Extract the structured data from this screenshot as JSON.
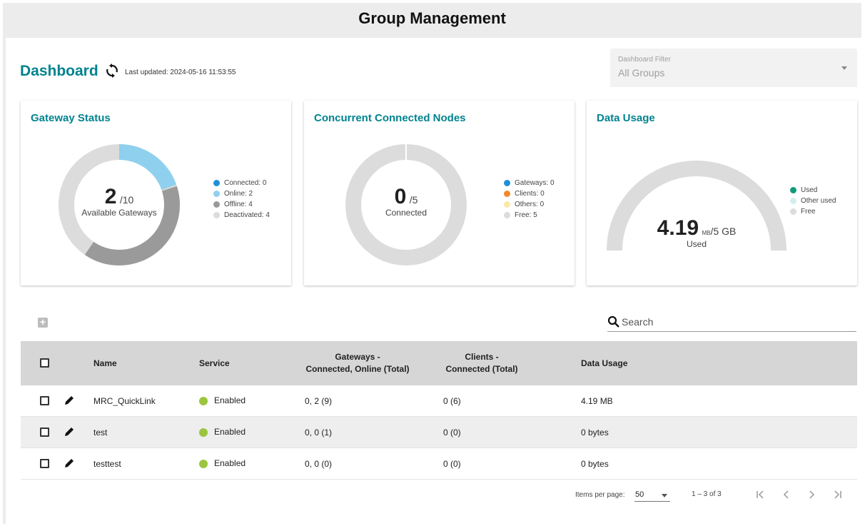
{
  "app": {
    "title": "Group Management"
  },
  "dashboard": {
    "title": "Dashboard",
    "last_updated": "Last updated: 2024-05-16 11:53:55",
    "filter": {
      "label": "Dashboard Filter",
      "value": "All Groups"
    }
  },
  "cards": {
    "gateway_status": {
      "title": "Gateway Status",
      "value": "2",
      "total": "/10",
      "subtitle": "Available Gateways",
      "legend": [
        {
          "label": "Connected: 0",
          "color": "#1e90d6",
          "value": 0
        },
        {
          "label": "Online: 2",
          "color": "#8fd0ee",
          "value": 2
        },
        {
          "label": "Offline: 4",
          "color": "#9a9a9a",
          "value": 4
        },
        {
          "label": "Deactivated: 4",
          "color": "#dcdcdc",
          "value": 4
        }
      ]
    },
    "connected_nodes": {
      "title": "Concurrent Connected Nodes",
      "value": "0",
      "total": "/5",
      "subtitle": "Connected",
      "legend": [
        {
          "label": "Gateways: 0",
          "color": "#1e90d6",
          "value": 0
        },
        {
          "label": "Clients: 0",
          "color": "#f08a2c",
          "value": 0
        },
        {
          "label": "Others: 0",
          "color": "#fbe8a6",
          "value": 0
        },
        {
          "label": "Free: 5",
          "color": "#dcdcdc",
          "value": 5
        }
      ]
    },
    "data_usage": {
      "title": "Data Usage",
      "value": "4.19",
      "unit": "MB",
      "total": "/5 GB",
      "subtitle": "Used",
      "legend": [
        {
          "label": "Used",
          "color": "#129a7a"
        },
        {
          "label": "Other used",
          "color": "#d4eeee"
        },
        {
          "label": "Free",
          "color": "#dcdcdc"
        }
      ]
    }
  },
  "search": {
    "placeholder": "Search"
  },
  "table": {
    "headers": {
      "name": "Name",
      "service": "Service",
      "gateways_line1": "Gateways -",
      "gateways_line2": "Connected, Online (Total)",
      "clients_line1": "Clients -",
      "clients_line2": "Connected (Total)",
      "data_usage": "Data Usage"
    },
    "rows": [
      {
        "name": "MRC_QuickLink",
        "service": "Enabled",
        "gateways": "0, 2 (9)",
        "clients": "0 (6)",
        "data_usage": "4.19 MB"
      },
      {
        "name": "test",
        "service": "Enabled",
        "gateways": "0, 0 (1)",
        "clients": "0 (0)",
        "data_usage": "0 bytes"
      },
      {
        "name": "testtest",
        "service": "Enabled",
        "gateways": "0, 0 (0)",
        "clients": "0 (0)",
        "data_usage": "0 bytes"
      }
    ],
    "status_color": "#9bc53d"
  },
  "pager": {
    "items_per_page_label": "Items per page:",
    "items_per_page": "50",
    "range": "1 – 3 of 3"
  }
}
